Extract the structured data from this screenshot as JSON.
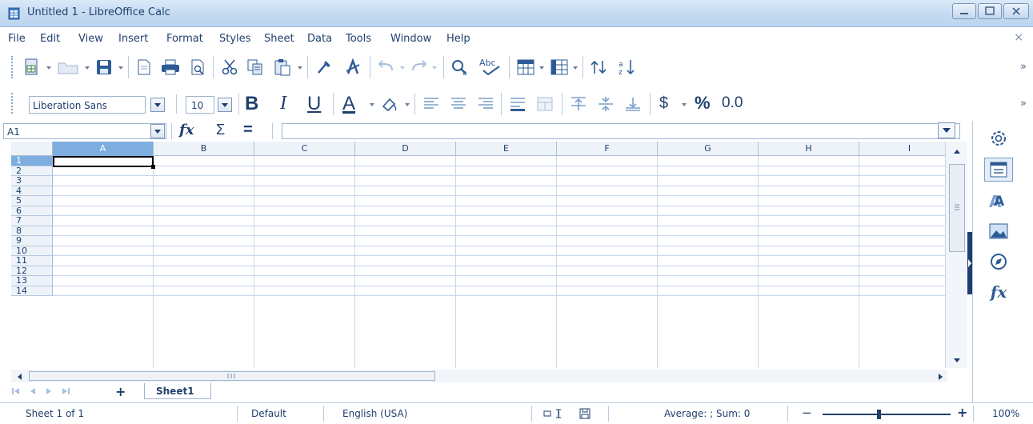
{
  "window": {
    "title": "Untitled 1 - LibreOffice Calc",
    "controls": [
      "minimize",
      "maximize",
      "close"
    ]
  },
  "menu": {
    "items": [
      "File",
      "Edit",
      "View",
      "Insert",
      "Format",
      "Styles",
      "Sheet",
      "Data",
      "Tools",
      "Window",
      "Help"
    ],
    "close_glyph": "×"
  },
  "standard_toolbar": {
    "icons": [
      "new-document-icon",
      "open-folder-icon",
      "save-icon",
      "export-pdf-icon",
      "print-icon",
      "print-preview-icon",
      "cut-icon",
      "copy-icon",
      "paste-icon",
      "clone-formatting-icon",
      "clear-formatting-icon",
      "undo-icon",
      "redo-icon",
      "find-replace-icon",
      "spelling-icon",
      "row-icon",
      "column-icon",
      "sort-icon",
      "sort-ascending-icon"
    ],
    "overflow": "»"
  },
  "formatting_toolbar": {
    "font_name": "Liberation Sans",
    "font_size": "10",
    "bold": "B",
    "italic": "I",
    "underline": "U",
    "font_color": "A",
    "currency": "$",
    "percent": "%",
    "number": "0.0",
    "overflow": "»"
  },
  "formula_bar": {
    "name_box": "A1",
    "function_wizard": "fx",
    "sum": "Σ",
    "formula": "=",
    "content": ""
  },
  "grid": {
    "columns": [
      "A",
      "B",
      "C",
      "D",
      "E",
      "F",
      "G",
      "H",
      "I"
    ],
    "rows": [
      "1",
      "2",
      "3",
      "4",
      "5",
      "6",
      "7",
      "8",
      "9",
      "10",
      "11",
      "12",
      "13",
      "14"
    ],
    "active_cell": "A1"
  },
  "sheet_tabs": {
    "add": "+",
    "tabs": [
      "Sheet1"
    ]
  },
  "sidebar": {
    "icons": [
      "settings-icon",
      "properties-icon",
      "styles-icon",
      "gallery-icon",
      "navigator-icon",
      "functions-icon"
    ],
    "functions_label": "fx"
  },
  "status_bar": {
    "sheet_info": "Sheet 1 of 1",
    "page_style": "Default",
    "language": "English (USA)",
    "statistics": "Average: ; Sum: 0",
    "zoom_minus": "−",
    "zoom_plus": "+",
    "zoom": "100%"
  },
  "colors": {
    "accent": "#1f3f6e",
    "header_active": "#7eaee0",
    "gridline": "#c8d7ea"
  }
}
